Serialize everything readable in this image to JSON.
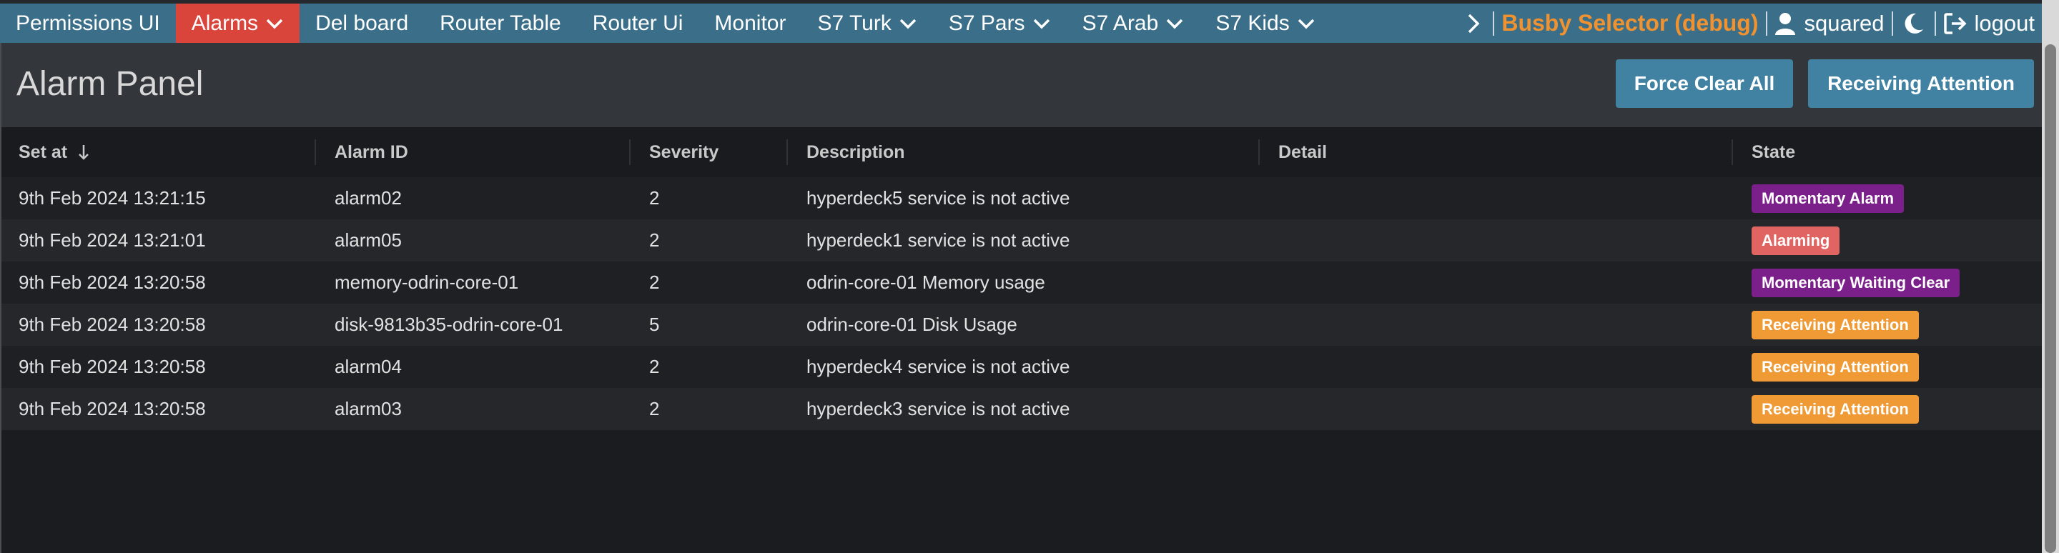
{
  "nav": {
    "items": [
      {
        "label": "Permissions UI",
        "dropdown": false,
        "active": false
      },
      {
        "label": "Alarms",
        "dropdown": true,
        "active": true
      },
      {
        "label": "Del board",
        "dropdown": false,
        "active": false
      },
      {
        "label": "Router Table",
        "dropdown": false,
        "active": false
      },
      {
        "label": "Router Ui",
        "dropdown": false,
        "active": false
      },
      {
        "label": "Monitor",
        "dropdown": false,
        "active": false
      },
      {
        "label": "S7 Turk",
        "dropdown": true,
        "active": false
      },
      {
        "label": "S7 Pars",
        "dropdown": true,
        "active": false
      },
      {
        "label": "S7 Arab",
        "dropdown": true,
        "active": false
      },
      {
        "label": "S7 Kids",
        "dropdown": true,
        "active": false
      }
    ],
    "brand": "Busby Selector (debug)",
    "user": "squared",
    "logout": "logout"
  },
  "header": {
    "title": "Alarm Panel",
    "force_clear": "Force Clear All",
    "receiving_attention": "Receiving Attention"
  },
  "table": {
    "columns": [
      "Set at",
      "Alarm ID",
      "Severity",
      "Description",
      "Detail",
      "State"
    ],
    "rows": [
      {
        "set_at": "9th Feb 2024 13:21:15",
        "alarm_id": "alarm02",
        "severity": "2",
        "description": "hyperdeck5 service is not active",
        "detail": "",
        "state": "Momentary Alarm",
        "state_color": "#7b1f8a"
      },
      {
        "set_at": "9th Feb 2024 13:21:01",
        "alarm_id": "alarm05",
        "severity": "2",
        "description": "hyperdeck1 service is not active",
        "detail": "",
        "state": "Alarming",
        "state_color": "#e06461"
      },
      {
        "set_at": "9th Feb 2024 13:20:58",
        "alarm_id": "memory-odrin-core-01",
        "severity": "2",
        "description": "odrin-core-01 Memory usage",
        "detail": "",
        "state": "Momentary Waiting Clear",
        "state_color": "#7b1f8a"
      },
      {
        "set_at": "9th Feb 2024 13:20:58",
        "alarm_id": "disk-9813b35-odrin-core-01",
        "severity": "5",
        "description": "odrin-core-01 Disk Usage",
        "detail": "",
        "state": "Receiving Attention",
        "state_color": "#ef9a34"
      },
      {
        "set_at": "9th Feb 2024 13:20:58",
        "alarm_id": "alarm04",
        "severity": "2",
        "description": "hyperdeck4 service is not active",
        "detail": "",
        "state": "Receiving Attention",
        "state_color": "#ef9a34"
      },
      {
        "set_at": "9th Feb 2024 13:20:58",
        "alarm_id": "alarm03",
        "severity": "2",
        "description": "hyperdeck3 service is not active",
        "detail": "",
        "state": "Receiving Attention",
        "state_color": "#ef9a34"
      }
    ]
  },
  "colors": {
    "navbar": "#3b6e88",
    "active_nav": "#d9443b",
    "brand": "#f0922f",
    "button": "#4182a3"
  },
  "icons": {
    "dropdown": "chevron-down-icon",
    "nav_expand": "chevron-right-icon",
    "user": "user-icon",
    "theme": "moon-icon",
    "logout": "logout-icon",
    "sort": "arrow-down-icon"
  }
}
